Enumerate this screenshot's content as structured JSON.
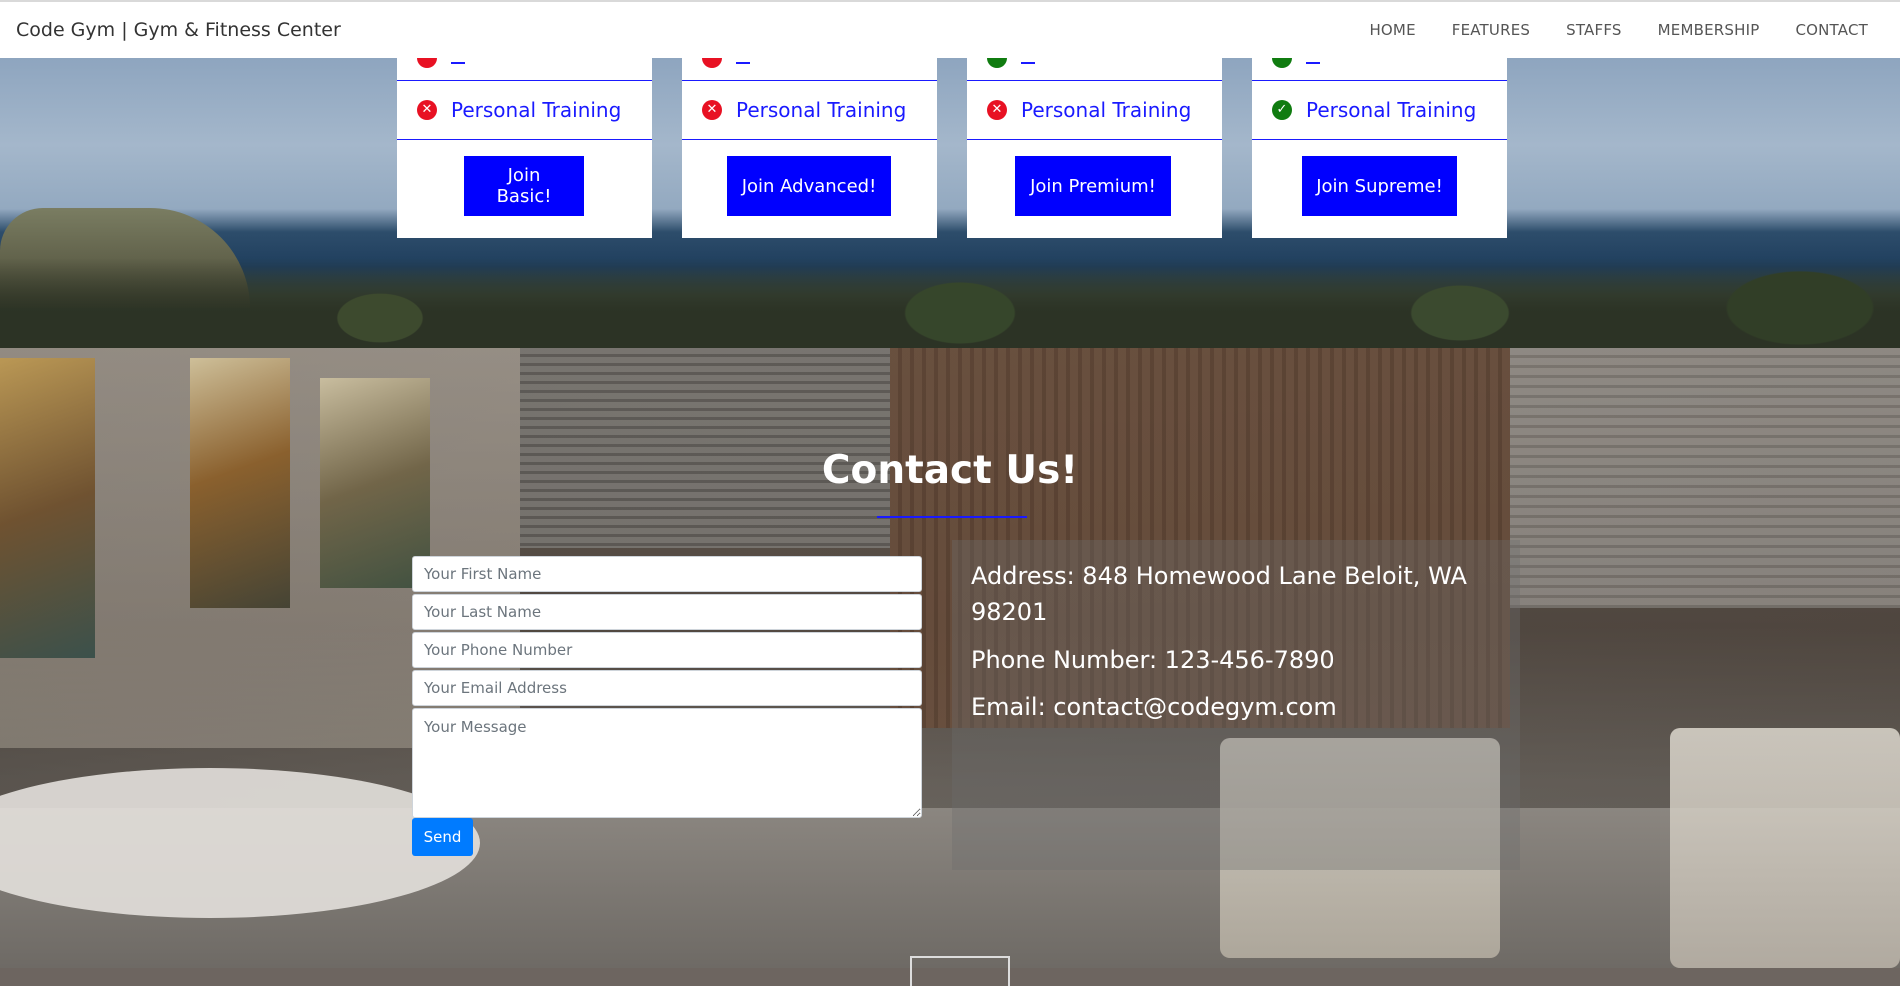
{
  "navbar": {
    "brand": "Code Gym | Gym & Fitness Center",
    "links": [
      "HOME",
      "FEATURES",
      "STAFFS",
      "MEMBERSHIP",
      "CONTACT"
    ]
  },
  "pricing": {
    "plans": [
      {
        "feature_label": "Personal Training",
        "included": false,
        "button": "Join Basic!",
        "top_row_included": false
      },
      {
        "feature_label": "Personal Training",
        "included": false,
        "button": "Join Advanced!",
        "top_row_included": false
      },
      {
        "feature_label": "Personal Training",
        "included": false,
        "button": "Join Premium!",
        "top_row_included": true
      },
      {
        "feature_label": "Personal Training",
        "included": true,
        "button": "Join Supreme!",
        "top_row_included": true
      }
    ],
    "icons": {
      "included": "check-circle-icon",
      "excluded": "x-circle-icon"
    },
    "colors": {
      "accent": "#0000ff",
      "excluded": "#e81123",
      "included": "#107c10"
    }
  },
  "contact": {
    "title": "Contact Us!",
    "form": {
      "first_name_placeholder": "Your First Name",
      "last_name_placeholder": "Your Last Name",
      "phone_placeholder": "Your Phone Number",
      "email_placeholder": "Your Email Address",
      "message_placeholder": "Your Message",
      "send_label": "Send"
    },
    "info": {
      "address": "Address: 848 Homewood Lane Beloit, WA 98201",
      "phone": "Phone Number: 123-456-7890",
      "email": "Email: contact@codegym.com"
    },
    "colors": {
      "send_button": "#007bff",
      "underline": "#1a1aff"
    }
  }
}
